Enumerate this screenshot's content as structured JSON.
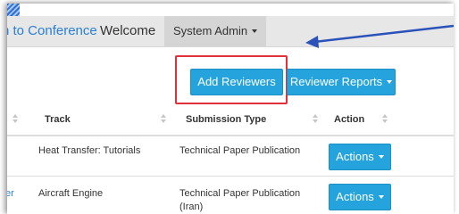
{
  "navbar": {
    "conference_link": "n to Conference",
    "welcome": "Welcome",
    "user_menu_label": "System Admin"
  },
  "toolbar": {
    "add_reviewers_label": "Add Reviewers",
    "reviewer_reports_label": "Reviewer Reports"
  },
  "table": {
    "columns": [
      "Track",
      "Submission Type",
      "Action"
    ],
    "rows": [
      {
        "left": "",
        "track": "Heat Transfer: Tutorials",
        "type": "Technical Paper Publication",
        "action": "Actions"
      },
      {
        "left": "er",
        "track": "Aircraft Engine",
        "type": "Technical Paper Publication (Iran)",
        "action": "Actions"
      }
    ]
  },
  "colors": {
    "button": "#24a3dc",
    "link": "#2a7fd4",
    "highlight": "#e0303a",
    "arrow": "#2a52b8",
    "navbar": "#e7e7e7"
  }
}
